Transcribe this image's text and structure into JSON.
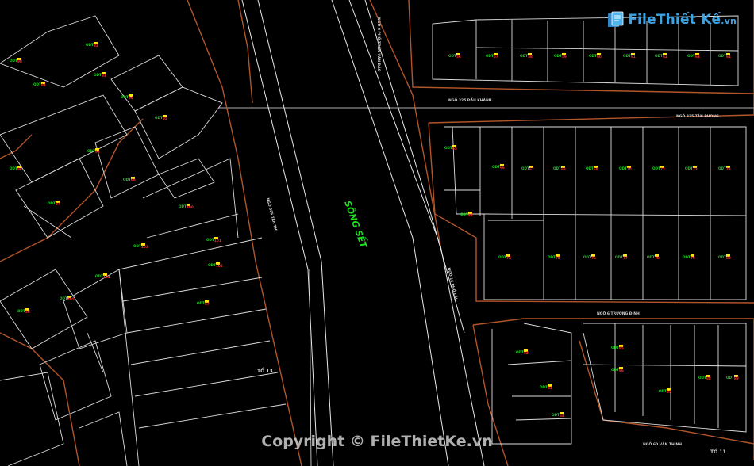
{
  "map": {
    "river_label": "SÔNG SẾT",
    "street_labels": [
      "NGÕ 8 PHỐ TRẦN VĂN BẢO",
      "NGÕ 325 ĐẦU KHÁNH",
      "NGÕ 335 TÂN PHONG",
      "NGÕ 325 TÂN THỊ",
      "TỔ 13",
      "NGÕ 16 PHỐ LÂU",
      "TỔ 11",
      "NGÕ 6 TRƯƠNG ĐỊNH",
      "NGÕ 60 VĂN THỊNH"
    ],
    "street_label_colors": {
      "default": "#cfcfcf"
    },
    "lot_code": "ODT",
    "lot_ids": [
      "56",
      "57",
      "58",
      "59",
      "60",
      "61",
      "62",
      "63",
      "64",
      "65",
      "66",
      "67",
      "68",
      "69",
      "70",
      "71",
      "72",
      "73",
      "74",
      "75",
      "76",
      "77",
      "78",
      "79",
      "80",
      "81",
      "82",
      "83",
      "84",
      "85",
      "86",
      "87",
      "88",
      "89",
      "90",
      "91",
      "92",
      "93",
      "94",
      "95",
      "96",
      "97",
      "98",
      "99",
      "100",
      "101",
      "102",
      "103",
      "104",
      "105"
    ],
    "colors": {
      "background": "#000000",
      "road_lines": "#e8e8e8",
      "boundary": "#b2552a",
      "lot_code": "#22d22a",
      "lot_number": "#ff2a2a",
      "lot_marker": "#ffe41a",
      "river_label": "#1fe01f"
    }
  },
  "logo": {
    "name": "File",
    "name2": "Thiết Kế",
    "suffix": ".vn"
  },
  "footer": {
    "copyright": "Copyright © FileThietKe.vn"
  }
}
